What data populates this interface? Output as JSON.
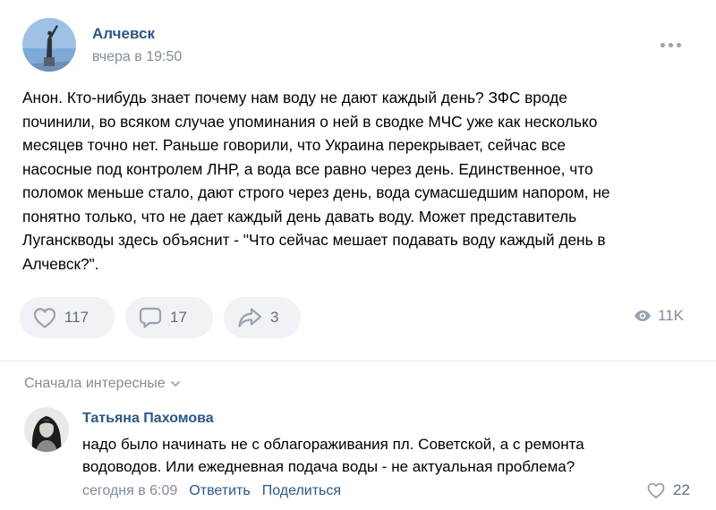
{
  "post": {
    "group_name": "Алчевск",
    "time": "вчера в 19:50",
    "text_lines": [
      "Анон. Кто-нибудь знает почему нам воду не дают каждый день? ЗФС вроде",
      "починили, во всяком случае упоминания о ней в сводке МЧС уже как несколько",
      "месяцев точно нет. Раньше говорили, что Украина перекрывает, сейчас все",
      "насосные под контролем ЛНР, а вода все равно через день. Единственное, что",
      "поломок меньше стало, дают строго через день, вода сумасшедшим напором, не",
      "понятно только, что не дает каждый день давать воду. Может представитель",
      "Луганскводы здесь объяснит - \"Что сейчас мешает подавать воду каждый день в",
      "Алчевск?\"."
    ],
    "likes": "117",
    "comments": "17",
    "shares": "3",
    "views": "11K"
  },
  "comments_section": {
    "sort_label": "Сначала интересные"
  },
  "comment": {
    "author": "Татьяна Пахомова",
    "text_lines": [
      "надо было начинать не с облагораживания пл. Советской, а с ремонта",
      "водоводов. Или ежедневная подача воды - не актуальная проблема?"
    ],
    "time": "сегодня в 6:09",
    "reply_label": "Ответить",
    "share_label": "Поделиться",
    "likes": "22"
  },
  "icons": {
    "more": "more-horizontal-icon",
    "like": "heart-outline-icon",
    "comment": "comment-bubble-icon",
    "share": "share-arrow-icon",
    "views": "eye-icon",
    "sort": "chevron-down-icon"
  },
  "colors": {
    "link": "#2a5885",
    "secondary": "#818c99",
    "pill_bg": "#f0f2f5",
    "icon": "#99a2ad"
  }
}
